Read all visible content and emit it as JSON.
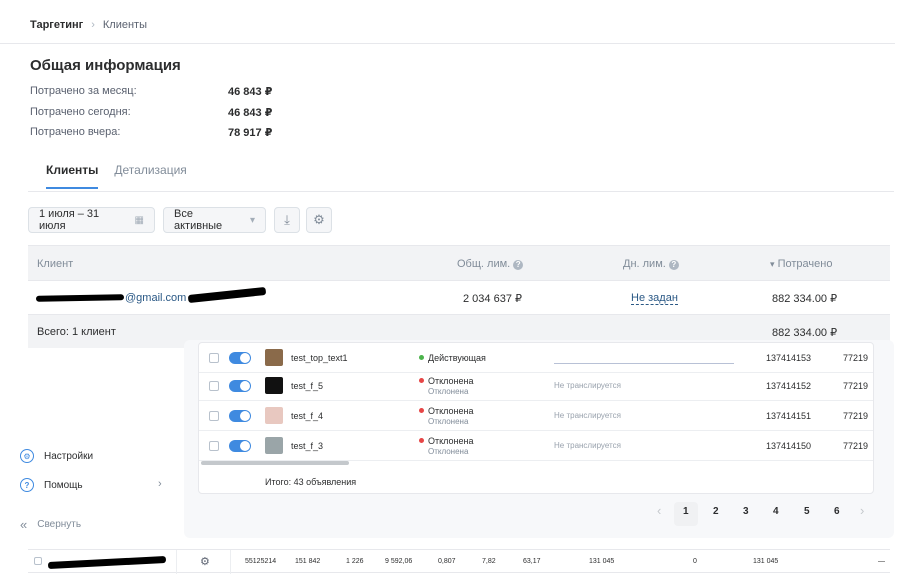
{
  "breadcrumb": {
    "item1": "Таргетинг",
    "separator": "›",
    "item2": "Клиенты"
  },
  "general_info": {
    "title": "Общая информация",
    "rows": [
      {
        "label": "Потрачено за месяц:",
        "value": "46 843 ₽"
      },
      {
        "label": "Потрачено сегодня:",
        "value": "46 843 ₽"
      },
      {
        "label": "Потрачено вчера:",
        "value": "78 917 ₽"
      }
    ]
  },
  "tabs": [
    {
      "label": "Клиенты",
      "active": true
    },
    {
      "label": "Детализация",
      "active": false
    }
  ],
  "toolbar": {
    "date_range": "1 июля – 31 июля",
    "filter": "Все активные",
    "download_icon": "download-icon",
    "settings_icon": "gear-icon"
  },
  "clients_table": {
    "headers": {
      "client": "Клиент",
      "total_limit": "Общ. лим.",
      "daily_limit": "Дн. лим.",
      "spent": "Потрачено"
    },
    "sort_arrow": "▾",
    "rows": [
      {
        "client": "@gmail.com",
        "total_limit": "2 034 637 ₽",
        "daily_limit": "Не задан",
        "spent": "882 334.00 ₽"
      }
    ],
    "footer": {
      "label": "Всего: 1 клиент",
      "spent": "882 334.00 ₽"
    }
  },
  "sidebar": {
    "settings": "Настройки",
    "help": "Помощь",
    "collapse": "Свернуть",
    "collapse_icon": "«",
    "help_chevron": "›"
  },
  "ads_table": {
    "rows": [
      {
        "name": "test_top_text1",
        "status": "Действующая",
        "status_sub": "",
        "status_color": "#4bb34b",
        "translation": "",
        "id": "137414153",
        "extra": "77219",
        "thumb": "#8a6a4a"
      },
      {
        "name": "test_f_5",
        "status": "Отклонена",
        "status_sub": "Отклонена",
        "status_color": "#e64646",
        "translation": "Не транслируется",
        "id": "137414152",
        "extra": "77219",
        "thumb": "#111111"
      },
      {
        "name": "test_f_4",
        "status": "Отклонена",
        "status_sub": "Отклонена",
        "status_color": "#e64646",
        "translation": "Не транслируется",
        "id": "137414151",
        "extra": "77219",
        "thumb": "#e8c8c0"
      },
      {
        "name": "test_f_3",
        "status": "Отклонена",
        "status_sub": "Отклонена",
        "status_color": "#e64646",
        "translation": "Не транслируется",
        "id": "137414150",
        "extra": "77219",
        "thumb": "#9aa5a8"
      }
    ],
    "total": "Итого: 43 объявления"
  },
  "pagination": {
    "prev": "‹",
    "pages": [
      "1",
      "2",
      "3",
      "4",
      "5",
      "6"
    ],
    "next": "›",
    "current": "1"
  },
  "bottom_row": {
    "values": [
      "55125214",
      "151 842",
      "1 226",
      "9 592,06",
      "0,807",
      "7,82",
      "63,17",
      "131 045",
      "0",
      "131 045",
      "—"
    ]
  }
}
